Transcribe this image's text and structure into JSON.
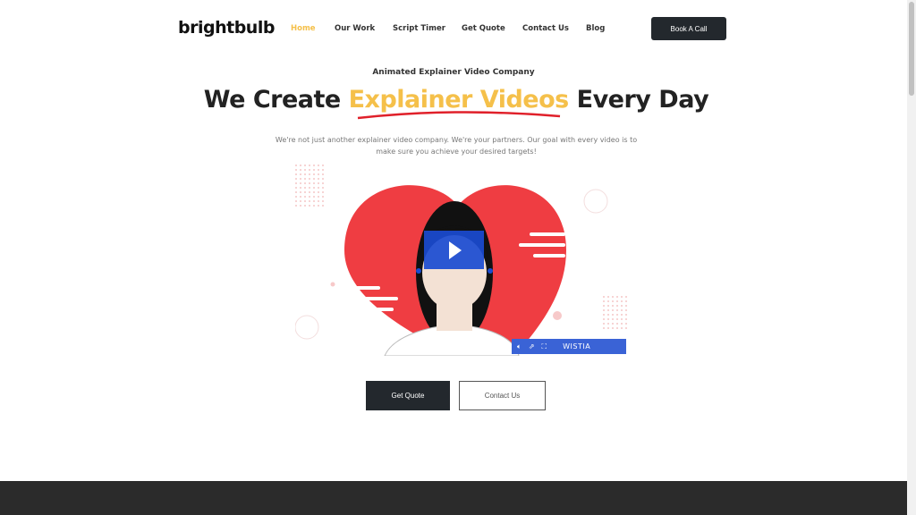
{
  "header": {
    "logo": "brightbulb",
    "nav": [
      {
        "label": "Home",
        "active": true
      },
      {
        "label": "Our Work"
      },
      {
        "label": "Script Timer"
      },
      {
        "label": "Get Quote"
      },
      {
        "label": "Contact Us"
      },
      {
        "label": "Blog"
      }
    ],
    "cta": "Book A Call"
  },
  "hero": {
    "eyebrow": "Animated Explainer Video Company",
    "title_pre": "We Create ",
    "title_highlight": "Explainer Videos",
    "title_post": " Every Day",
    "subtitle": "We're not just another explainer video company. We're your partners. Our goal with every video is to make sure you achieve your desired targets!",
    "primary_button": "Get Quote",
    "secondary_button": "Contact Us"
  },
  "video": {
    "provider": "WISTIA",
    "icons": [
      "volume-icon",
      "share-icon",
      "fullscreen-icon"
    ]
  },
  "colors": {
    "accent": "#f5c04a",
    "dark": "#23282d",
    "heart": "#ef3d42",
    "player": "#1a4bd1"
  }
}
